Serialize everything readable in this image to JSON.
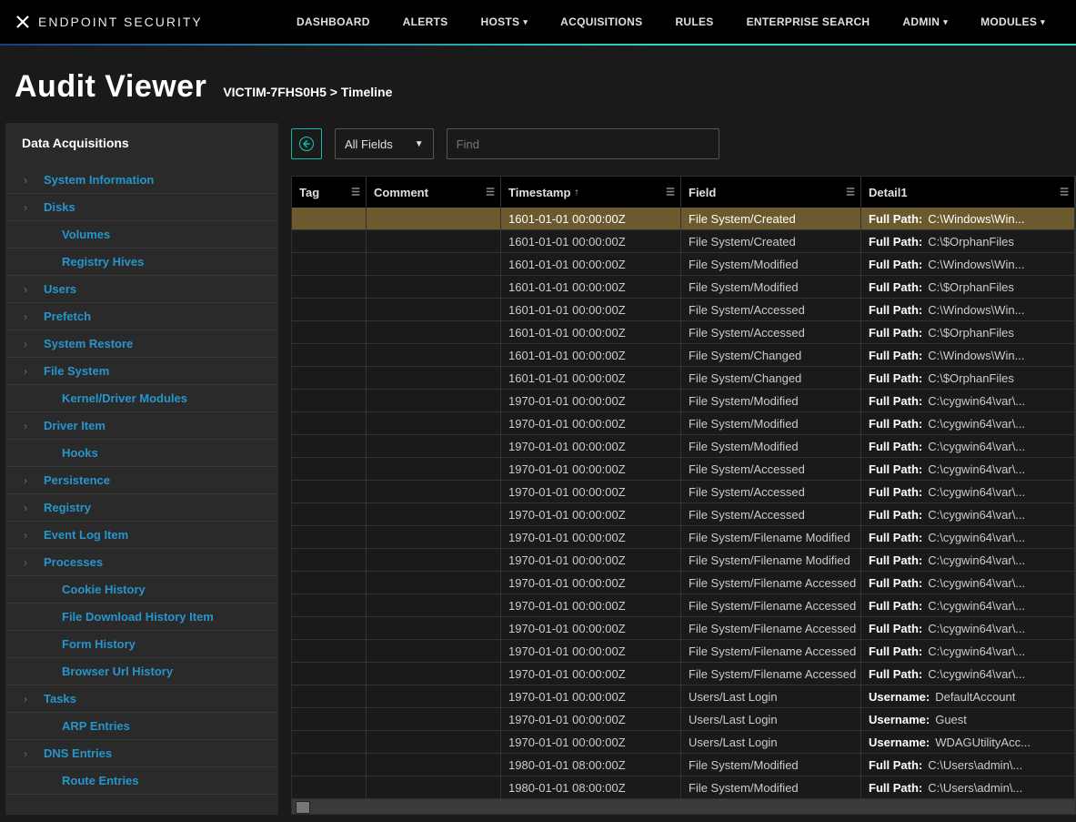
{
  "brand": "ENDPOINT SECURITY",
  "nav": [
    "DASHBOARD",
    "ALERTS",
    "HOSTS",
    "ACQUISITIONS",
    "RULES",
    "ENTERPRISE SEARCH",
    "ADMIN",
    "MODULES"
  ],
  "nav_caret": [
    false,
    false,
    true,
    false,
    false,
    false,
    true,
    true
  ],
  "page_title": "Audit Viewer",
  "breadcrumb": "VICTIM-7FHS0H5 > Timeline",
  "sidebar_title": "Data Acquisitions",
  "sidebar_items": [
    {
      "label": "System Information",
      "exp": true
    },
    {
      "label": "Disks",
      "exp": true
    },
    {
      "label": "Volumes",
      "exp": false,
      "child": true
    },
    {
      "label": "Registry Hives",
      "exp": false,
      "child": true
    },
    {
      "label": "Users",
      "exp": true
    },
    {
      "label": "Prefetch",
      "exp": true
    },
    {
      "label": "System Restore",
      "exp": true
    },
    {
      "label": "File System",
      "exp": true
    },
    {
      "label": "Kernel/Driver Modules",
      "exp": false,
      "child": true
    },
    {
      "label": "Driver Item",
      "exp": true
    },
    {
      "label": "Hooks",
      "exp": false,
      "child": true
    },
    {
      "label": "Persistence",
      "exp": true
    },
    {
      "label": "Registry",
      "exp": true
    },
    {
      "label": "Event Log Item",
      "exp": true
    },
    {
      "label": "Processes",
      "exp": true
    },
    {
      "label": "Cookie History",
      "exp": false,
      "child": true
    },
    {
      "label": "File Download History Item",
      "exp": false,
      "child": true
    },
    {
      "label": "Form History",
      "exp": false,
      "child": true
    },
    {
      "label": "Browser Url History",
      "exp": false,
      "child": true
    },
    {
      "label": "Tasks",
      "exp": true
    },
    {
      "label": "ARP Entries",
      "exp": false,
      "child": true
    },
    {
      "label": "DNS Entries",
      "exp": true
    },
    {
      "label": "Route Entries",
      "exp": false,
      "child": true
    }
  ],
  "toolbar": {
    "filter_field": "All Fields",
    "search_placeholder": "Find"
  },
  "columns": [
    "Tag",
    "Comment",
    "Timestamp",
    "Field",
    "Detail1"
  ],
  "sort_col": 2,
  "rows": [
    {
      "ts": "1601-01-01 00:00:00Z",
      "field": "File System/Created",
      "dkey": "Full Path:",
      "dval": "C:\\Windows\\Win...",
      "sel": true
    },
    {
      "ts": "1601-01-01 00:00:00Z",
      "field": "File System/Created",
      "dkey": "Full Path:",
      "dval": "C:\\$OrphanFiles"
    },
    {
      "ts": "1601-01-01 00:00:00Z",
      "field": "File System/Modified",
      "dkey": "Full Path:",
      "dval": "C:\\Windows\\Win..."
    },
    {
      "ts": "1601-01-01 00:00:00Z",
      "field": "File System/Modified",
      "dkey": "Full Path:",
      "dval": "C:\\$OrphanFiles"
    },
    {
      "ts": "1601-01-01 00:00:00Z",
      "field": "File System/Accessed",
      "dkey": "Full Path:",
      "dval": "C:\\Windows\\Win..."
    },
    {
      "ts": "1601-01-01 00:00:00Z",
      "field": "File System/Accessed",
      "dkey": "Full Path:",
      "dval": "C:\\$OrphanFiles"
    },
    {
      "ts": "1601-01-01 00:00:00Z",
      "field": "File System/Changed",
      "dkey": "Full Path:",
      "dval": "C:\\Windows\\Win..."
    },
    {
      "ts": "1601-01-01 00:00:00Z",
      "field": "File System/Changed",
      "dkey": "Full Path:",
      "dval": "C:\\$OrphanFiles"
    },
    {
      "ts": "1970-01-01 00:00:00Z",
      "field": "File System/Modified",
      "dkey": "Full Path:",
      "dval": "C:\\cygwin64\\var\\..."
    },
    {
      "ts": "1970-01-01 00:00:00Z",
      "field": "File System/Modified",
      "dkey": "Full Path:",
      "dval": "C:\\cygwin64\\var\\..."
    },
    {
      "ts": "1970-01-01 00:00:00Z",
      "field": "File System/Modified",
      "dkey": "Full Path:",
      "dval": "C:\\cygwin64\\var\\..."
    },
    {
      "ts": "1970-01-01 00:00:00Z",
      "field": "File System/Accessed",
      "dkey": "Full Path:",
      "dval": "C:\\cygwin64\\var\\..."
    },
    {
      "ts": "1970-01-01 00:00:00Z",
      "field": "File System/Accessed",
      "dkey": "Full Path:",
      "dval": "C:\\cygwin64\\var\\..."
    },
    {
      "ts": "1970-01-01 00:00:00Z",
      "field": "File System/Accessed",
      "dkey": "Full Path:",
      "dval": "C:\\cygwin64\\var\\..."
    },
    {
      "ts": "1970-01-01 00:00:00Z",
      "field": "File System/Filename Modified",
      "dkey": "Full Path:",
      "dval": "C:\\cygwin64\\var\\..."
    },
    {
      "ts": "1970-01-01 00:00:00Z",
      "field": "File System/Filename Modified",
      "dkey": "Full Path:",
      "dval": "C:\\cygwin64\\var\\..."
    },
    {
      "ts": "1970-01-01 00:00:00Z",
      "field": "File System/Filename Accessed",
      "dkey": "Full Path:",
      "dval": "C:\\cygwin64\\var\\..."
    },
    {
      "ts": "1970-01-01 00:00:00Z",
      "field": "File System/Filename Accessed",
      "dkey": "Full Path:",
      "dval": "C:\\cygwin64\\var\\..."
    },
    {
      "ts": "1970-01-01 00:00:00Z",
      "field": "File System/Filename Accessed",
      "dkey": "Full Path:",
      "dval": "C:\\cygwin64\\var\\..."
    },
    {
      "ts": "1970-01-01 00:00:00Z",
      "field": "File System/Filename Accessed",
      "dkey": "Full Path:",
      "dval": "C:\\cygwin64\\var\\..."
    },
    {
      "ts": "1970-01-01 00:00:00Z",
      "field": "File System/Filename Accessed",
      "dkey": "Full Path:",
      "dval": "C:\\cygwin64\\var\\..."
    },
    {
      "ts": "1970-01-01 00:00:00Z",
      "field": "Users/Last Login",
      "dkey": "Username:",
      "dval": "DefaultAccount"
    },
    {
      "ts": "1970-01-01 00:00:00Z",
      "field": "Users/Last Login",
      "dkey": "Username:",
      "dval": "Guest"
    },
    {
      "ts": "1970-01-01 00:00:00Z",
      "field": "Users/Last Login",
      "dkey": "Username:",
      "dval": "WDAGUtilityAcc..."
    },
    {
      "ts": "1980-01-01 08:00:00Z",
      "field": "File System/Modified",
      "dkey": "Full Path:",
      "dval": "C:\\Users\\admin\\..."
    },
    {
      "ts": "1980-01-01 08:00:00Z",
      "field": "File System/Modified",
      "dkey": "Full Path:",
      "dval": "C:\\Users\\admin\\..."
    }
  ]
}
